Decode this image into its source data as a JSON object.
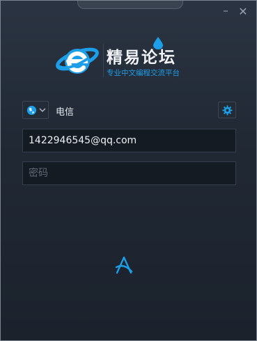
{
  "window": {
    "minimize_glyph": "–",
    "close_glyph": "✕"
  },
  "logo": {
    "title": "精易论坛",
    "subtitle": "专业中文编程交流平台",
    "brand_color": "#1c9fe8"
  },
  "network": {
    "isp_label": "电信"
  },
  "login": {
    "account_value": "1422946545@qq.com",
    "password_placeholder": "密码"
  },
  "colors": {
    "background": "#212935",
    "accent": "#1c9fe8",
    "field_bg": "#151b23"
  },
  "icons": {
    "globe": "globe-icon",
    "chevron": "chevron-down-icon",
    "settings": "gear-icon",
    "loading": "loading-icon"
  }
}
